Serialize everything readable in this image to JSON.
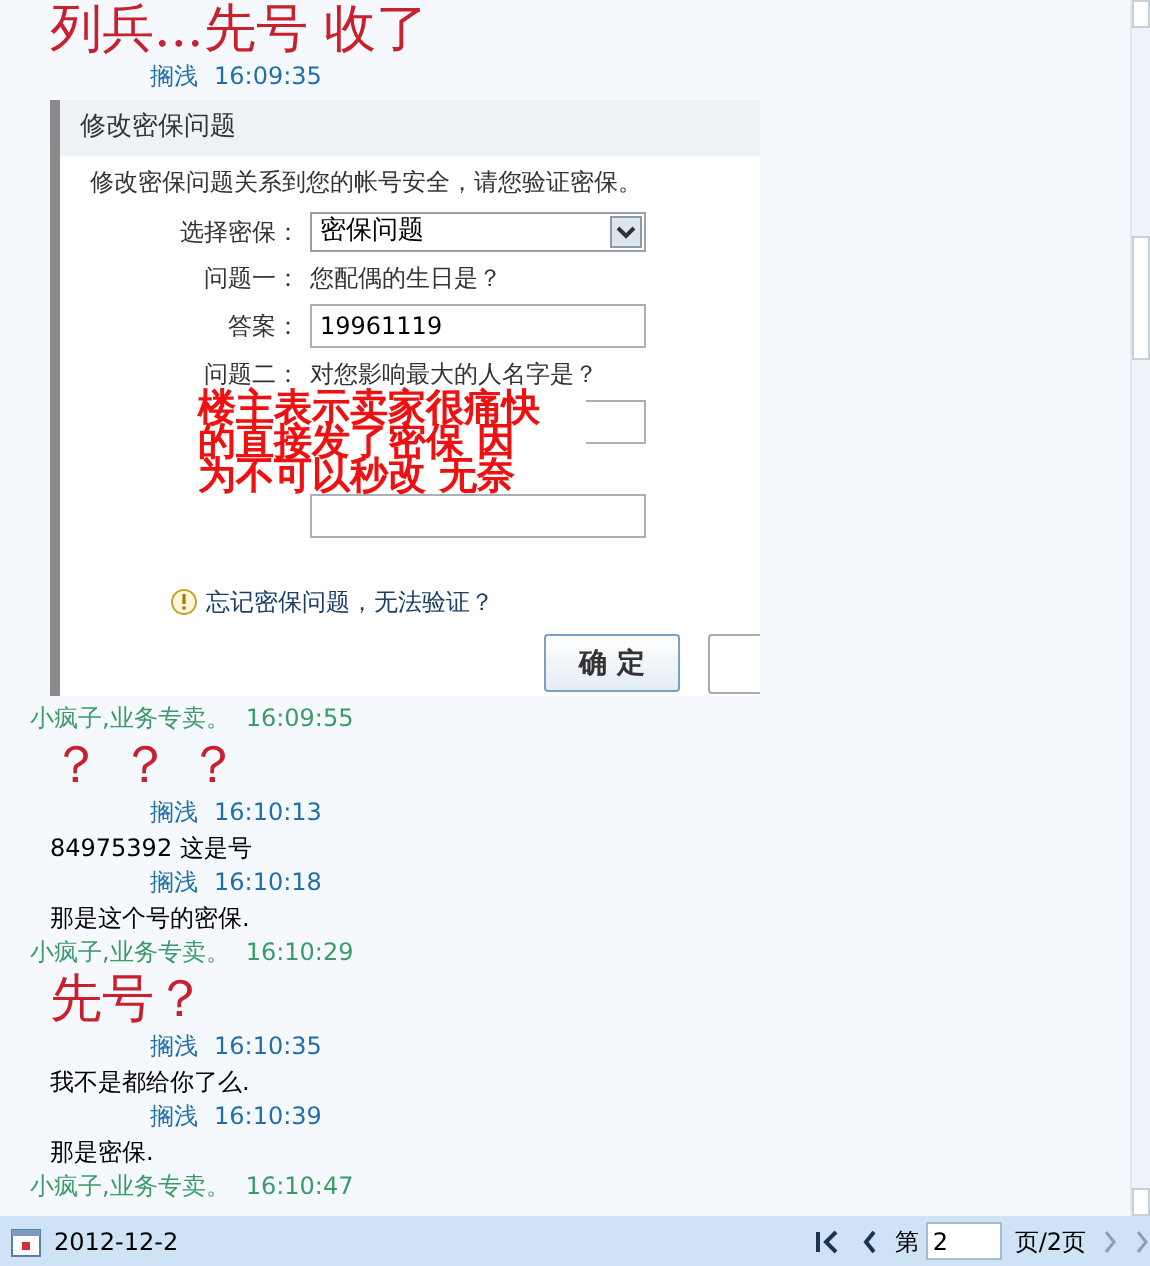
{
  "entries": [
    {
      "kind": "big",
      "text": "列兵...先号 收了"
    },
    {
      "kind": "outgoing",
      "sender": "搁浅",
      "time": "16:09:35"
    },
    {
      "dialog": {
        "title": "修改密保问题",
        "intro": "修改密保问题关系到您的帐号安全，请您验证密保。",
        "select_label": "选择密保：",
        "select_value": "密保问题",
        "q1_label": "问题一：",
        "q1": "您配偶的生日是？",
        "answer_label": "答案：",
        "answer": "19961119",
        "q2_label": "问题二：",
        "q2": "对您影响最大的人名字是？",
        "annotation": [
          "楼主表示卖家很痛快",
          "的直接发了密保 因",
          "为不可以秒改 无奈"
        ],
        "forgot_link": "忘记密保问题，无法验证？",
        "ok_button": "确 定"
      }
    },
    {
      "kind": "incoming",
      "sender": "小疯子,业务专卖。",
      "time": "16:09:55"
    },
    {
      "kind": "big",
      "text": "？ ？ ？"
    },
    {
      "kind": "outgoing",
      "sender": "搁浅",
      "time": "16:10:13"
    },
    {
      "kind": "text",
      "text": "84975392 这是号"
    },
    {
      "kind": "outgoing",
      "sender": "搁浅",
      "time": "16:10:18"
    },
    {
      "kind": "text",
      "text": "那是这个号的密保."
    },
    {
      "kind": "incoming",
      "sender": "小疯子,业务专卖。",
      "time": "16:10:29"
    },
    {
      "kind": "big",
      "text": "先号？"
    },
    {
      "kind": "outgoing",
      "sender": "搁浅",
      "time": "16:10:35"
    },
    {
      "kind": "text",
      "text": "我不是都给你了么."
    },
    {
      "kind": "outgoing",
      "sender": "搁浅",
      "time": "16:10:39"
    },
    {
      "kind": "text",
      "text": "那是密保."
    },
    {
      "kind": "incoming",
      "sender": "小疯子,业务专卖。",
      "time": "16:10:47"
    }
  ],
  "footer": {
    "date": "2012-12-2",
    "page_prefix": "第",
    "page": "2",
    "page_suffix": "页/2页"
  }
}
